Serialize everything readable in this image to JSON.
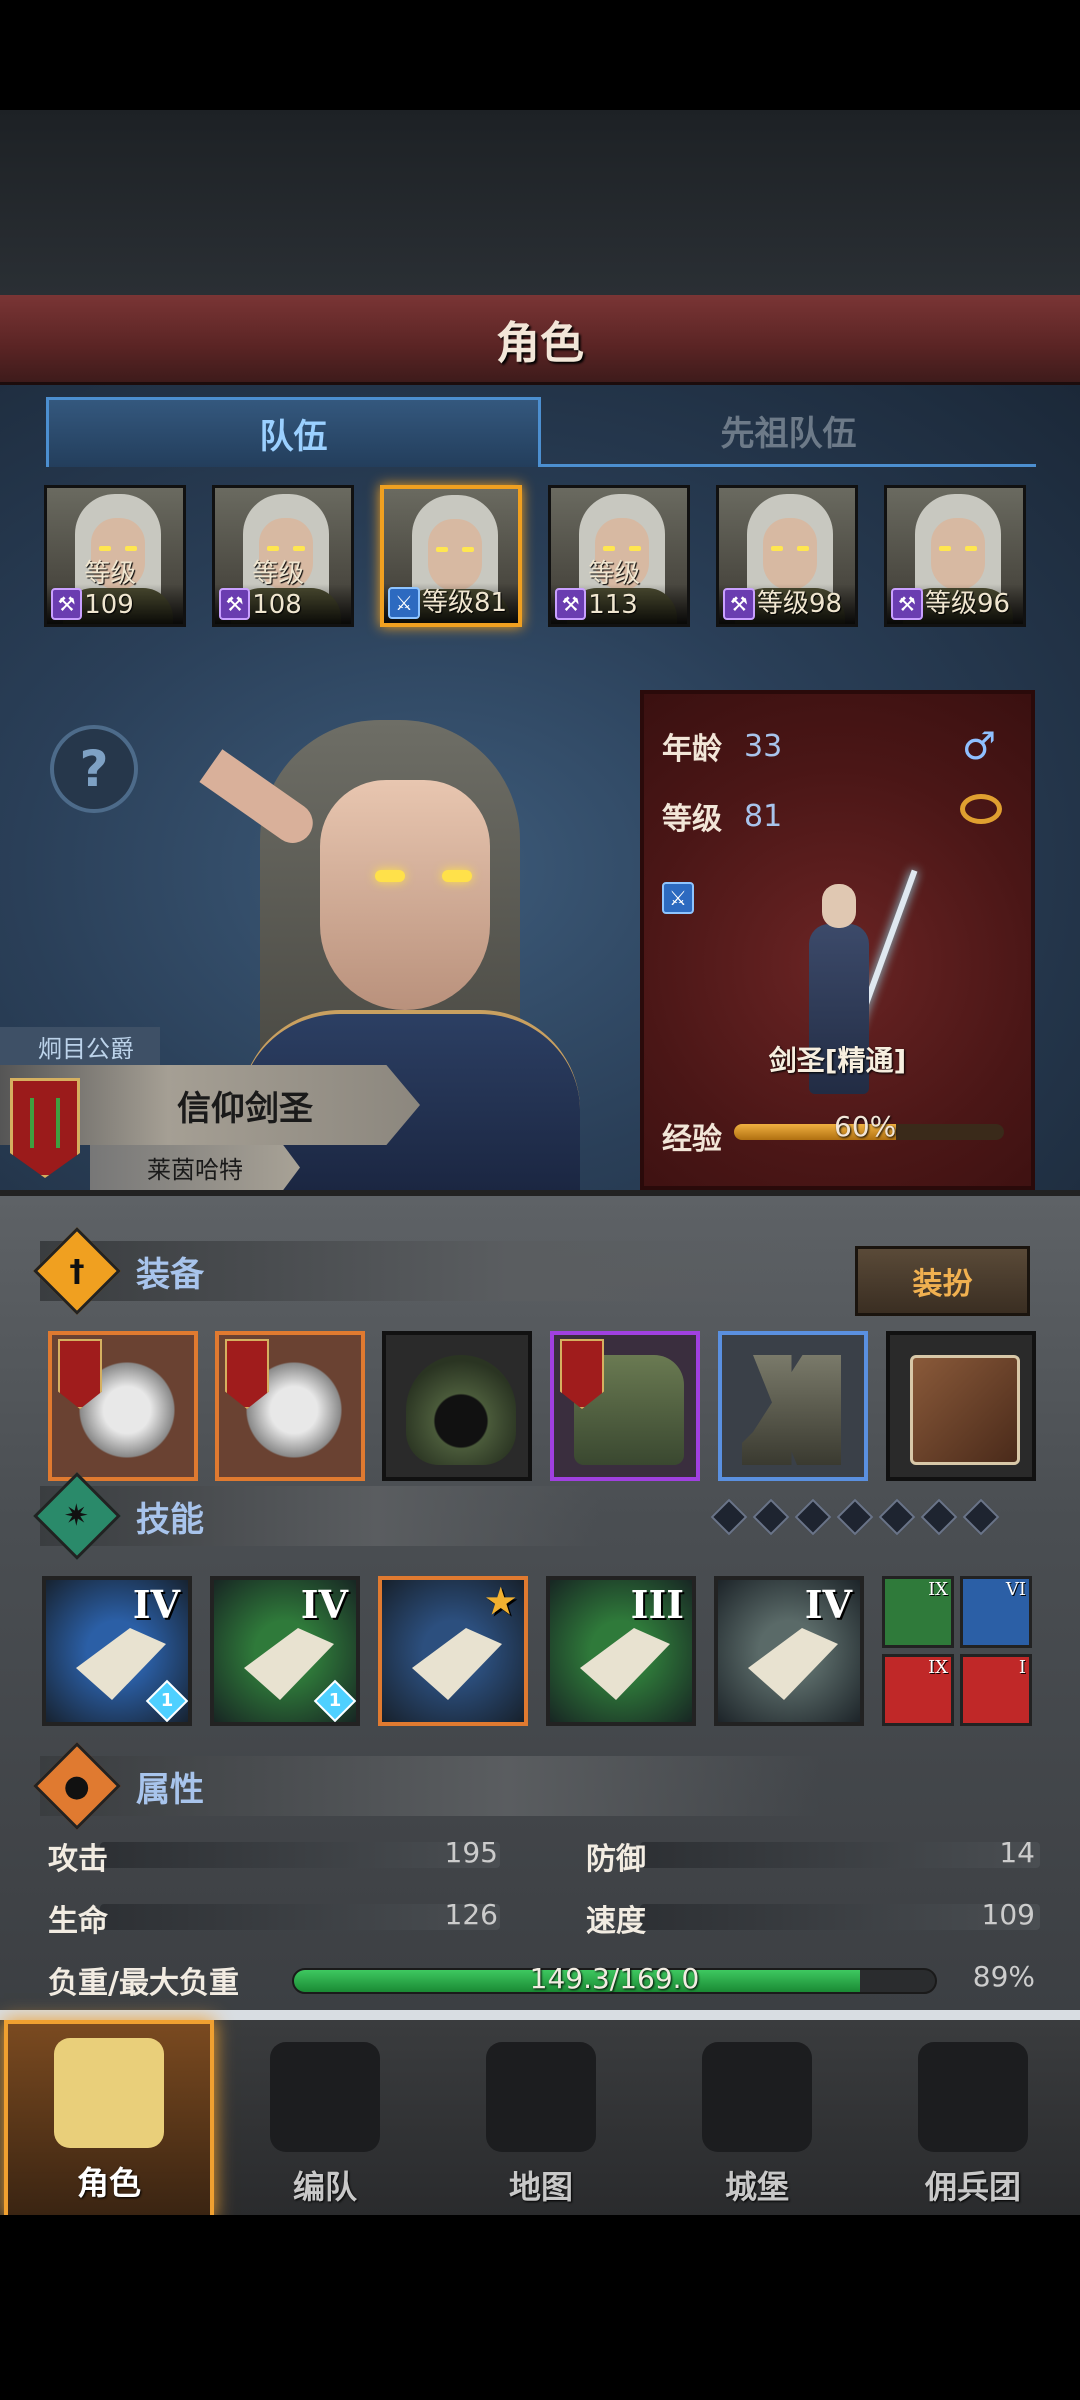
{
  "header": {
    "title": "角色"
  },
  "tabs": [
    {
      "label": "队伍",
      "active": true
    },
    {
      "label": "先祖队伍",
      "active": false
    }
  ],
  "level_prefix": "等级",
  "roster": [
    {
      "level": "等级109",
      "class": "purple"
    },
    {
      "level": "等级108",
      "class": "purple"
    },
    {
      "level": "等级81",
      "class": "blue",
      "selected": true
    },
    {
      "level": "等级113",
      "class": "purple"
    },
    {
      "level": "等级98",
      "class": "purple"
    },
    {
      "level": "等级96",
      "class": "purple"
    }
  ],
  "help_icon": "?",
  "hero": {
    "title": "炯目公爵",
    "name": "信仰剑圣",
    "origin": "莱茵哈特"
  },
  "info_card": {
    "age_label": "年龄",
    "age": "33",
    "gender_icon": "♂",
    "level_label": "等级",
    "level": "81",
    "class_name": "剑圣[精通]",
    "exp_label": "经验",
    "exp_percent": "60%",
    "exp_fraction": 0.6
  },
  "equipment": {
    "title": "装备",
    "dress_button": "装扮",
    "icon": "†",
    "items": [
      {
        "name": "axe",
        "rarity": "orange"
      },
      {
        "name": "axe",
        "rarity": "orange"
      },
      {
        "name": "hood",
        "rarity": "common"
      },
      {
        "name": "armor",
        "rarity": "purple"
      },
      {
        "name": "boots",
        "rarity": "blue"
      },
      {
        "name": "book",
        "rarity": "common"
      }
    ]
  },
  "skills": {
    "title": "技能",
    "icon": "✷",
    "slots_total": 7,
    "main": [
      {
        "rank": "IV",
        "color": "#2b5fa6",
        "badge": "1"
      },
      {
        "rank": "IV",
        "color": "#2f7a3a",
        "badge": "1"
      },
      {
        "rank": "",
        "color": "#2c4f7e",
        "badge": "",
        "star": "★"
      },
      {
        "rank": "III",
        "color": "#2f7a3a",
        "badge": ""
      },
      {
        "rank": "IV",
        "color": "#5a6a68",
        "badge": ""
      }
    ],
    "mini": [
      {
        "rank": "IX",
        "color": "#2f7a3a"
      },
      {
        "rank": "VI",
        "color": "#2b5fa6"
      },
      {
        "rank": "IX",
        "color": "#c02828"
      },
      {
        "rank": "I",
        "color": "#c02828"
      }
    ]
  },
  "attributes": {
    "title": "属性",
    "attack_label": "攻击",
    "attack": "195",
    "defense_label": "防御",
    "defense": "14",
    "hp_label": "生命",
    "hp": "126",
    "speed_label": "速度",
    "speed": "109",
    "weight_label": "负重/最大负重",
    "weight": "149.3/169.0",
    "weight_percent": "89%",
    "weight_fraction": 0.883
  },
  "nav": [
    {
      "label": "角色",
      "active": true
    },
    {
      "label": "编队",
      "active": false
    },
    {
      "label": "地图",
      "active": false
    },
    {
      "label": "城堡",
      "active": false
    },
    {
      "label": "佣兵团",
      "active": false
    }
  ],
  "colors": {
    "accent": "#f0a020",
    "tab_border": "#4c8fd0",
    "title_bar": "#6a2c2c"
  }
}
